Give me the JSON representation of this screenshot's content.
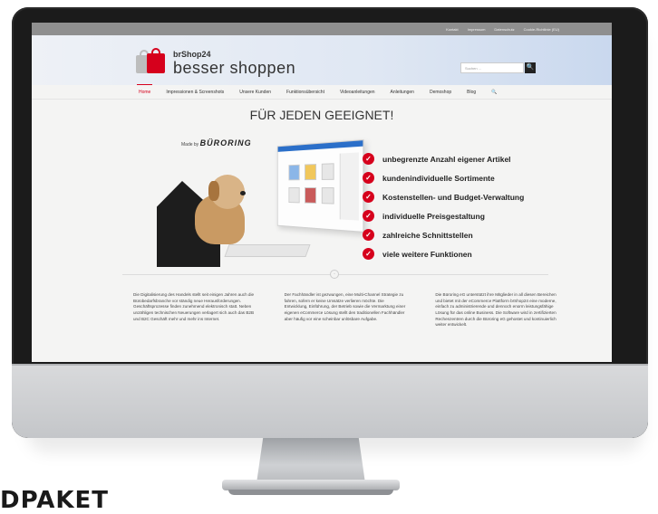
{
  "topbar": {
    "links": [
      "Kontakt",
      "Impressum",
      "Datenschutz",
      "Cookie-Richtlinie (EU)"
    ]
  },
  "header": {
    "brand": "brShop24",
    "slogan": "besser shoppen",
    "search_placeholder": "Suchen ...",
    "search_button": "🔍"
  },
  "nav": {
    "items": [
      "Home",
      "Impressionen & Screenshots",
      "Unsere Kunden",
      "Funktionsübersicht",
      "Videoanleitungen",
      "Anleitungen",
      "Demoshop",
      "Blog",
      "🔍"
    ],
    "active": "Home"
  },
  "main": {
    "title": "FÜR JEDEN GEEIGNET!",
    "madeby_prefix": "Made by",
    "madeby_brand": "BÜRORING",
    "features": [
      "unbegrenzte Anzahl eigener Artikel",
      "kundenindividuelle Sortimente",
      "Kostenstellen- und Budget-Verwaltung",
      "individuelle Preisgestaltung",
      "zahlreiche Schnittstellen",
      "viele weitere Funktionen"
    ],
    "check_icon": "✓"
  },
  "columns": [
    "Die Digitalisierung des Handels stellt seit einigen Jahren auch die Bürobedarfsbranche vor ständig neue Herausforderungen. Geschäftsprozesse finden zunehmend elektronisch statt. Neben unzähligen technischen Neuerungen verlagert sich auch das B2B und B2C Geschäft mehr und mehr ins Internet.",
    "Der Fachhändler ist gezwungen, eine Multi-Channel Strategie zu fahren, sofern er keine Umsätze verlieren möchte. Die Entwicklung, Einführung, der Betrieb sowie die Vermarktung einer eigenen eCommerce Lösung stellt den traditionellen Fachhändler aber häufig vor eine scheinbar unlösbare Aufgabe.",
    "Die Büroring eG unterstützt ihre Mitglieder in all diesen Bereichen und bietet mit der eCommerce Plattform brShop24 eine moderne, einfach zu administrierende und dennoch enorm leistungsfähige Lösung für das online Business. Die Software wird in zertifizierten Rechenzentren durch die Büroring eG gehostet und kontinuierlich weiter entwickelt."
  ],
  "footer_wordmark": "DPAKET",
  "colors": {
    "accent": "#d6001c",
    "topbar": "#8f8f8f"
  }
}
